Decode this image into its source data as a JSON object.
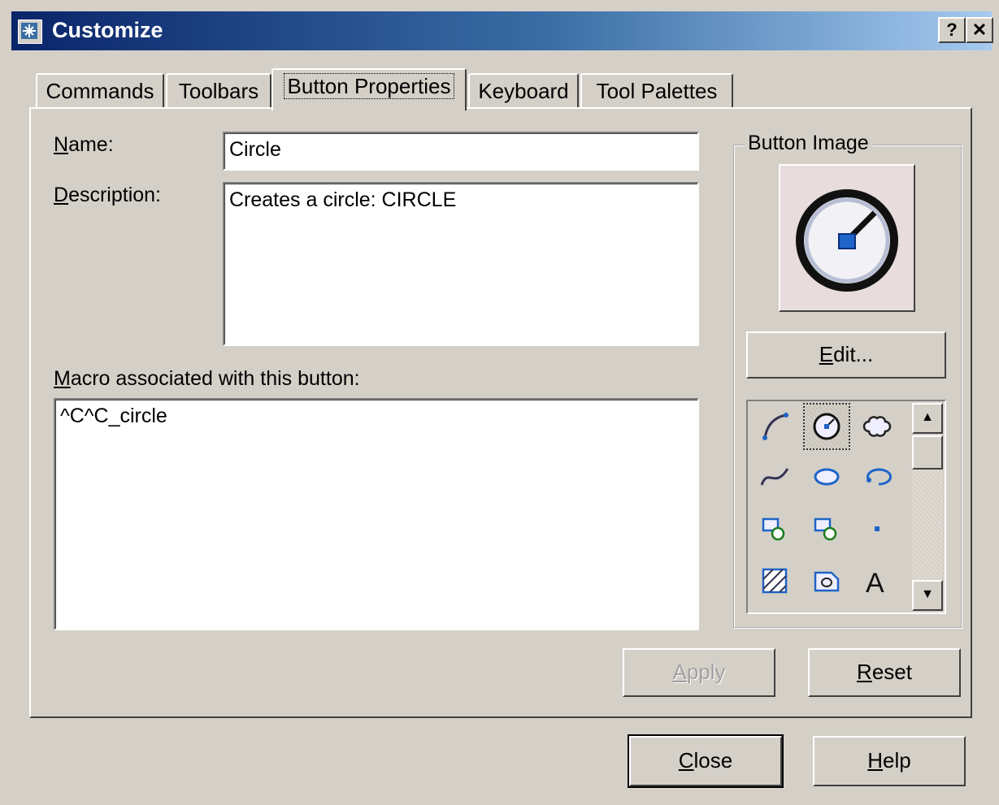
{
  "window": {
    "title": "Customize",
    "help_btn": "?",
    "close_btn": "✕"
  },
  "tabs": [
    {
      "label": "Commands"
    },
    {
      "label": "Toolbars"
    },
    {
      "label": "Button Properties",
      "active": true
    },
    {
      "label": "Keyboard"
    },
    {
      "label": "Tool Palettes"
    }
  ],
  "form": {
    "name_label_key": "N",
    "name_label_rest": "ame:",
    "name_value": "Circle",
    "desc_label_key": "D",
    "desc_label_rest": "escription:",
    "desc_value": "Creates a circle:  CIRCLE",
    "macro_label_key": "M",
    "macro_label_rest": "acro associated with this button:",
    "macro_value": "^C^C_circle"
  },
  "button_image": {
    "group_label": "Button Image",
    "edit_key": "E",
    "edit_rest": "dit...",
    "icons": [
      "arc-icon",
      "circle-icon",
      "revcloud-icon",
      "spline-icon",
      "ellipse-icon",
      "ellipse-arc-icon",
      "insert-block-icon",
      "make-block-icon",
      "point-icon",
      "hatch-icon",
      "region-icon",
      "text-icon"
    ]
  },
  "panel_buttons": {
    "apply_key": "A",
    "apply_rest": "pply",
    "reset_key": "R",
    "reset_rest": "eset"
  },
  "footer_buttons": {
    "close_key": "C",
    "close_rest": "lose",
    "help_key": "H",
    "help_rest": "elp"
  }
}
